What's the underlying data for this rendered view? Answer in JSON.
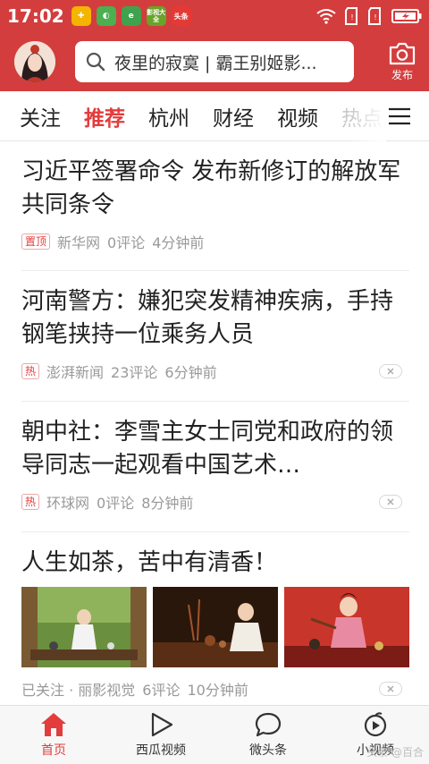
{
  "status_bar": {
    "time": "17:02",
    "apps": [
      "影视大全",
      "头条"
    ]
  },
  "header": {
    "search_placeholder": "夜里的寂寞 | 霸王别姬影...",
    "publish_label": "发布"
  },
  "tabs": [
    "关注",
    "推荐",
    "杭州",
    "财经",
    "视频",
    "热点"
  ],
  "active_tab": "推荐",
  "articles": [
    {
      "title": "习近平签署命令 发布新修订的解放军共同条令",
      "tag": "置顶",
      "source": "新华网",
      "comments": "0评论",
      "time": "4分钟前"
    },
    {
      "title": "河南警方：嫌犯突发精神疾病，手持钢笔挟持一位乘务人员",
      "tag": "热",
      "source": "澎湃新闻",
      "comments": "23评论",
      "time": "6分钟前"
    },
    {
      "title": "朝中社：李雪主女士同党和政府的领导同志一起观看中国艺术…",
      "tag": "热",
      "source": "环球网",
      "comments": "0评论",
      "time": "8分钟前"
    },
    {
      "title": "人生如茶，苦中有清香！",
      "source": "已关注 · 丽影视觉",
      "comments": "6评论",
      "time": "10分钟前"
    }
  ],
  "bottom_nav": [
    {
      "label": "首页",
      "icon": "home-icon"
    },
    {
      "label": "西瓜视频",
      "icon": "play-icon"
    },
    {
      "label": "微头条",
      "icon": "chat-bubble-icon"
    },
    {
      "label": "小视频",
      "icon": "short-video-icon"
    }
  ],
  "watermark": "头条 @百合",
  "colors": {
    "brand_red": "#d43d3d",
    "active_red": "#e33c3c",
    "meta_gray": "#999999"
  }
}
